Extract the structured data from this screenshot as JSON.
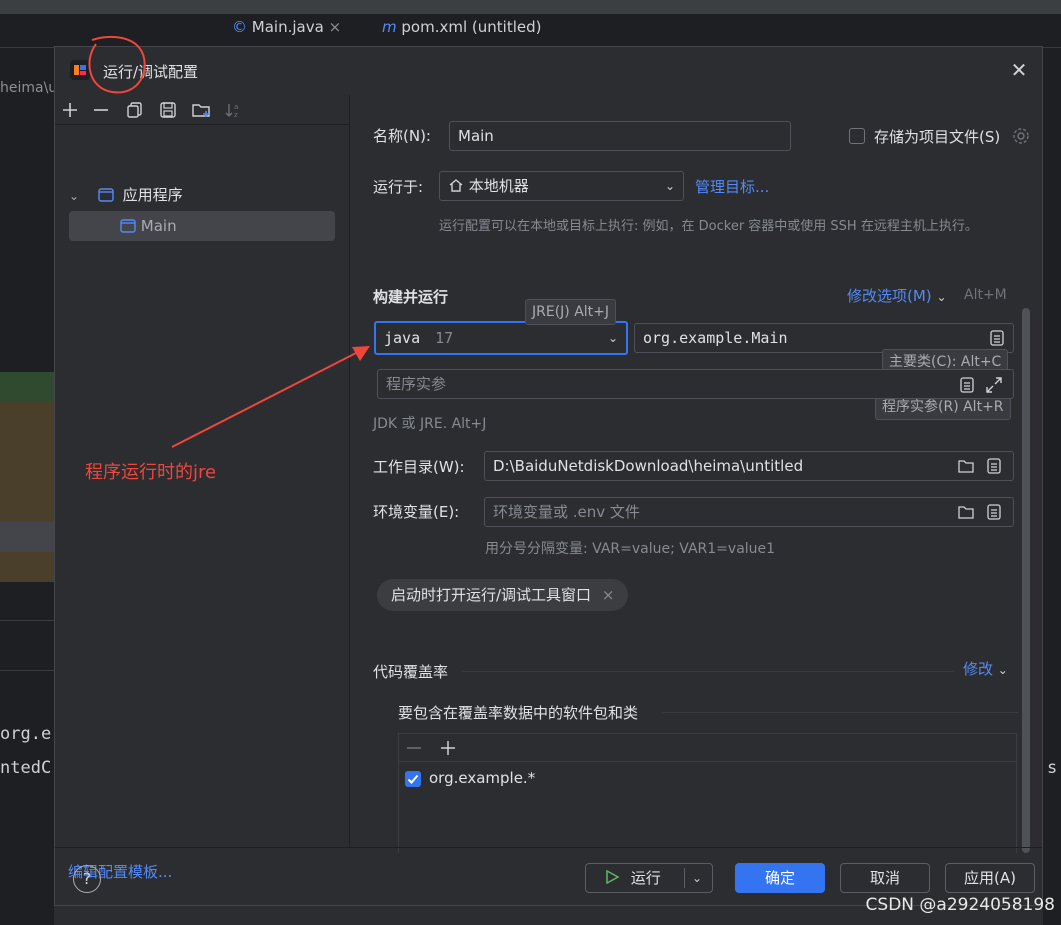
{
  "background": {
    "tab1": "Main.java",
    "tab2": "pom.xml (untitled)",
    "path_fragment": "heima\\u",
    "code_line1": "org.e",
    "code_line2": "ntedC",
    "right_fragment": "s"
  },
  "dialog": {
    "title": "运行/调试配置",
    "close_icon": "close-icon"
  },
  "sidebar": {
    "tree": [
      {
        "label": "应用程序",
        "icon": "application-icon",
        "expanded": true
      },
      {
        "label": "Main",
        "icon": "class-icon",
        "selected": true
      }
    ],
    "edit_templates": "编辑配置模板..."
  },
  "form": {
    "name_label": "名称(N):",
    "name_value": "Main",
    "store_label": "存储为项目文件(S)",
    "run_on_label": "运行于:",
    "run_on_value": "本地机器",
    "manage_targets": "管理目标...",
    "run_on_hint": "运行配置可以在本地或目标上执行: 例如，在 Docker 容器中或使用 SSH 在远程主机上执行。",
    "build_run_title": "构建并运行",
    "modify_options": "修改选项(M)",
    "modify_shortcut": "Alt+M",
    "jre_tip": "JRE(J) Alt+J",
    "jre_name": "java",
    "jre_version": "17",
    "main_class_value": "org.example.Main",
    "main_class_tip": "主要类(C): Alt+C",
    "args_tip": "程序实参(R) Alt+R",
    "args_placeholder": "程序实参",
    "jdk_hint": "JDK 或 JRE. Alt+J",
    "workdir_label": "工作目录(W):",
    "workdir_value": "D:\\BaiduNetdiskDownload\\heima\\untitled",
    "env_label": "环境变量(E):",
    "env_placeholder": "环境变量或 .env 文件",
    "env_hint": "用分号分隔变量: VAR=value; VAR1=value1",
    "chip_label": "启动时打开运行/调试工具窗口",
    "coverage_title": "代码覆盖率",
    "coverage_modify": "修改",
    "coverage_include": "要包含在覆盖率数据中的软件包和类",
    "coverage_pkg": "org.example.*"
  },
  "footer": {
    "help": "?",
    "run": "运行",
    "ok": "确定",
    "cancel": "取消",
    "apply": "应用(A)"
  },
  "annotation": {
    "text": "程序运行时的jre",
    "color": "#f0463c"
  },
  "watermark": "CSDN @a2924058198"
}
